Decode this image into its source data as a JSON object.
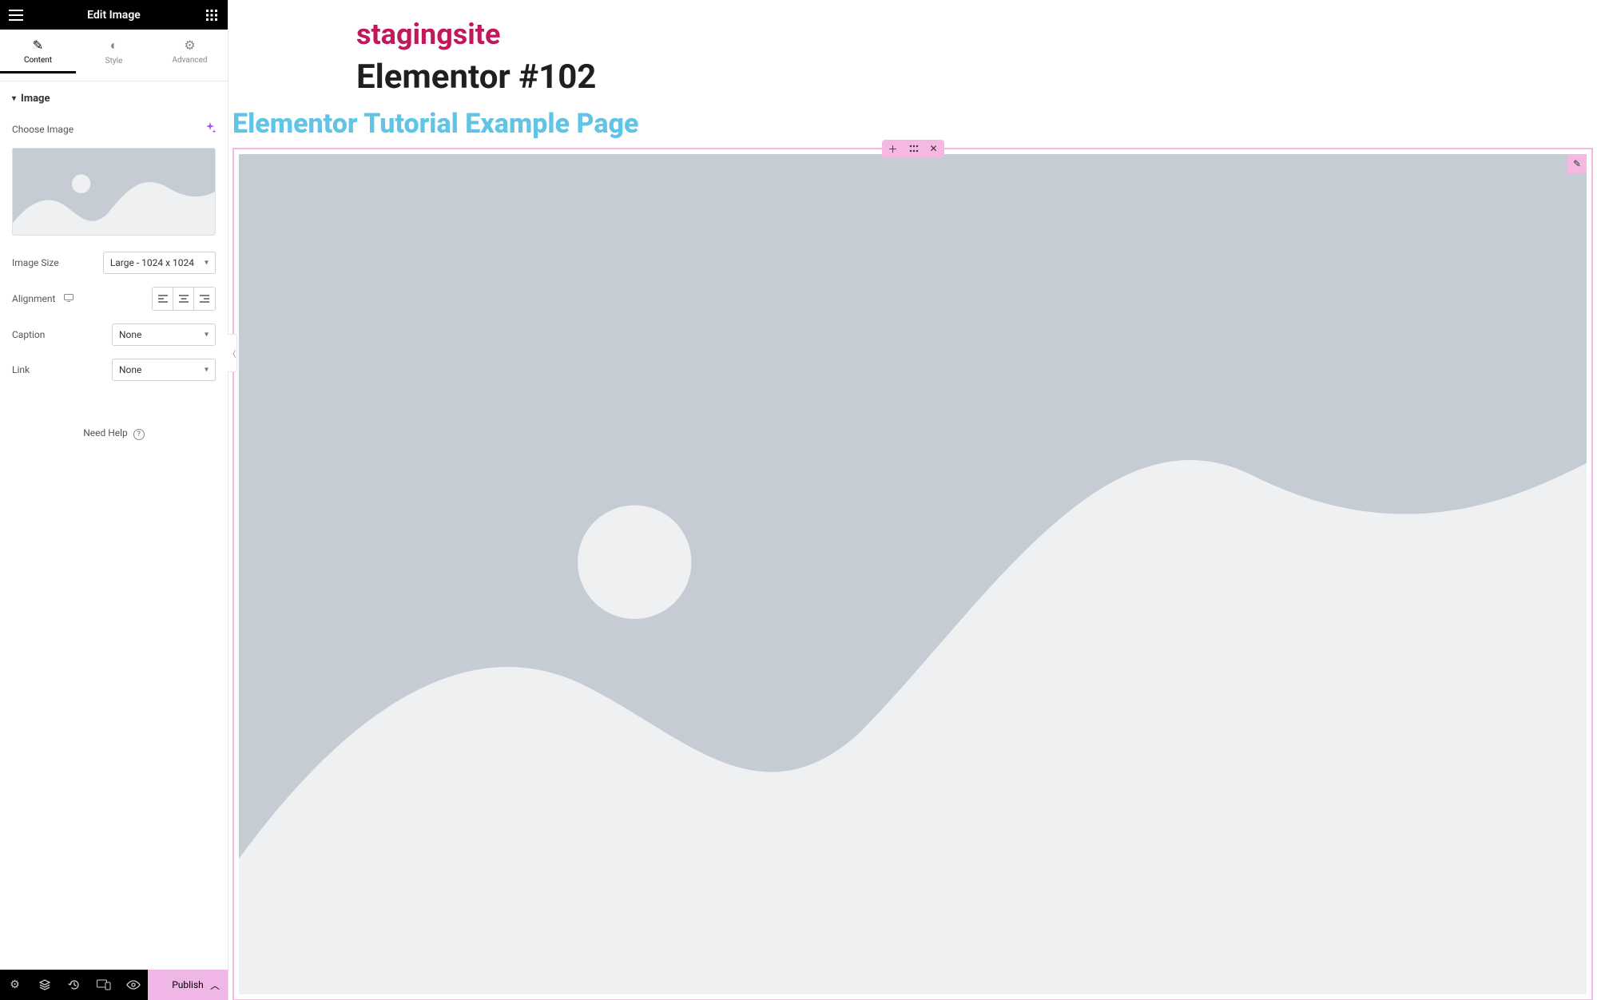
{
  "header": {
    "title": "Edit Image"
  },
  "tabs": {
    "content": "Content",
    "style": "Style",
    "advanced": "Advanced"
  },
  "section": {
    "title": "Image"
  },
  "controls": {
    "choose_image_label": "Choose Image",
    "image_size_label": "Image Size",
    "image_size_value": "Large - 1024 x 1024",
    "alignment_label": "Alignment",
    "caption_label": "Caption",
    "caption_value": "None",
    "link_label": "Link",
    "link_value": "None"
  },
  "help": {
    "label": "Need Help"
  },
  "footer": {
    "publish": "Publish"
  },
  "canvas": {
    "site_title": "stagingsite",
    "page_title": "Elementor #102",
    "section_heading": "Elementor Tutorial Example Page"
  },
  "icons": {
    "hamburger": "hamburger-icon",
    "apps": "apps-grid-icon",
    "pencil": "pencil-icon",
    "contrast": "contrast-icon",
    "gear": "gear-icon",
    "ai": "sparkle-icon",
    "desktop": "desktop-icon",
    "align_left": "align-left-icon",
    "align_center": "align-center-icon",
    "align_right": "align-right-icon",
    "settings": "settings-icon",
    "layers": "layers-icon",
    "history": "history-icon",
    "responsive": "responsive-icon",
    "preview": "preview-icon",
    "chevron_up": "chevron-up-icon",
    "chevron_left": "chevron-left-icon",
    "plus": "plus-icon",
    "drag": "drag-handle-icon",
    "close": "close-icon"
  }
}
